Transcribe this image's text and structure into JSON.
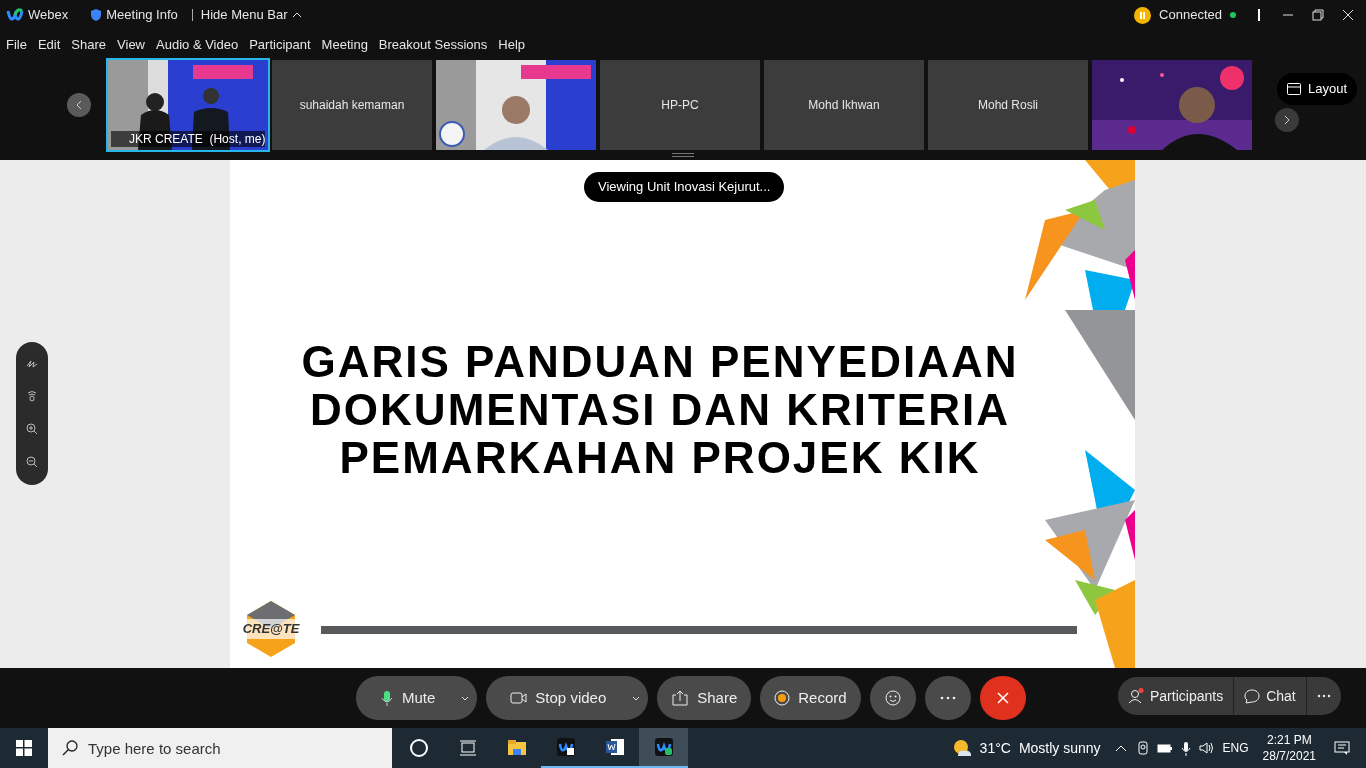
{
  "title_bar": {
    "app": "Webex",
    "meeting_info": "Meeting Info",
    "hide_menu": "Hide Menu Bar",
    "status": "Connected"
  },
  "menu": [
    "File",
    "Edit",
    "Share",
    "View",
    "Audio & Video",
    "Participant",
    "Meeting",
    "Breakout Sessions",
    "Help"
  ],
  "participants": [
    {
      "kind": "video",
      "label": "JKR CREATE  (Host, me)",
      "selected": true
    },
    {
      "kind": "name",
      "label": "suhaidah kemaman",
      "selected": false
    },
    {
      "kind": "video",
      "selected": false
    },
    {
      "kind": "name",
      "label": "HP-PC",
      "selected": false
    },
    {
      "kind": "name",
      "label": "Mohd Ikhwan",
      "selected": false
    },
    {
      "kind": "name",
      "label": "Mohd Rosli",
      "selected": false
    },
    {
      "kind": "video",
      "selected": false
    }
  ],
  "layout_button": "Layout",
  "share_banner": "Viewing Unit Inovasi Kejurut...",
  "slide": {
    "title_lines": [
      "GARIS PANDUAN PENYEDIAAN",
      "DOKUMENTASI DAN KRITERIA",
      "PEMARKAHAN PROJEK KIK"
    ],
    "logo": "CRE@TE"
  },
  "controls": [
    {
      "kind": "mute",
      "label": "Mute",
      "caret": true
    },
    {
      "kind": "video",
      "label": "Stop video",
      "caret": true
    },
    {
      "kind": "share",
      "label": "Share",
      "caret": false
    },
    {
      "kind": "record",
      "label": "Record",
      "caret": false
    },
    {
      "kind": "reactions"
    },
    {
      "kind": "more"
    },
    {
      "kind": "end"
    }
  ],
  "side_controls": [
    {
      "kind": "participants",
      "label": "Participants"
    },
    {
      "kind": "chat",
      "label": "Chat"
    },
    {
      "kind": "more"
    }
  ],
  "taskbar": {
    "search_placeholder": "Type here to search",
    "temperature": "31°C",
    "weather": "Mostly sunny",
    "language": "ENG",
    "time": "2:21 PM",
    "date": "28/7/2021"
  }
}
